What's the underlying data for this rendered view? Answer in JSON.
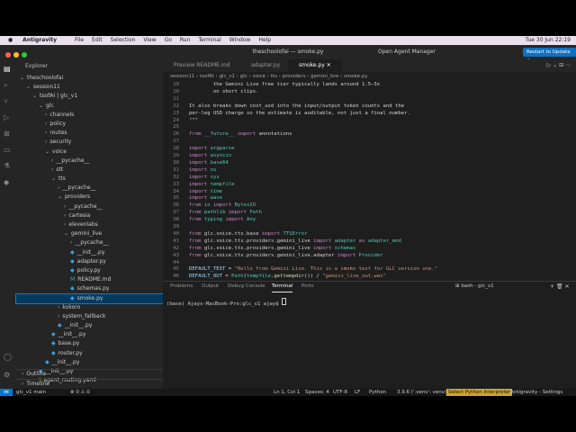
{
  "macmenu": {
    "app": "Antigravity",
    "items": [
      "File",
      "Edit",
      "Selection",
      "View",
      "Go",
      "Run",
      "Terminal",
      "Window",
      "Help"
    ],
    "clock": "Tue 30 Jun  22:19"
  },
  "window": {
    "title": "theschoolofai — smoke.py",
    "agent_manager": "Open Agent Manager",
    "restart": "Restart to Update ⇧"
  },
  "explorer": {
    "header": "Explorer",
    "tree": [
      {
        "label": "theschoolofai",
        "kind": "folder",
        "depth": 0,
        "open": true
      },
      {
        "label": "session11",
        "kind": "folder",
        "depth": 1,
        "open": true
      },
      {
        "label": "tsofAI | glc_v1",
        "kind": "folder",
        "depth": 2,
        "open": true
      },
      {
        "label": "glc",
        "kind": "folder",
        "depth": 3,
        "open": true
      },
      {
        "label": "channels",
        "kind": "folder",
        "depth": 4,
        "open": false
      },
      {
        "label": "policy",
        "kind": "folder",
        "depth": 4,
        "open": false
      },
      {
        "label": "routes",
        "kind": "folder",
        "depth": 4,
        "open": false
      },
      {
        "label": "security",
        "kind": "folder",
        "depth": 4,
        "open": false
      },
      {
        "label": "voice",
        "kind": "folder",
        "depth": 4,
        "open": true
      },
      {
        "label": "__pycache__",
        "kind": "folder",
        "depth": 5,
        "open": false
      },
      {
        "label": "stt",
        "kind": "folder",
        "depth": 5,
        "open": false
      },
      {
        "label": "tts",
        "kind": "folder",
        "depth": 5,
        "open": true
      },
      {
        "label": "__pycache__",
        "kind": "folder",
        "depth": 6,
        "open": false
      },
      {
        "label": "providers",
        "kind": "folder",
        "depth": 6,
        "open": true
      },
      {
        "label": "__pycache__",
        "kind": "folder",
        "depth": 7,
        "open": false
      },
      {
        "label": "cartesia",
        "kind": "folder",
        "depth": 7,
        "open": false
      },
      {
        "label": "elevenlabs",
        "kind": "folder",
        "depth": 7,
        "open": false
      },
      {
        "label": "gemini_live",
        "kind": "folder",
        "depth": 7,
        "open": true
      },
      {
        "label": "__pycache__",
        "kind": "folder",
        "depth": 8,
        "open": false
      },
      {
        "label": "__init__.py",
        "kind": "py",
        "depth": 8
      },
      {
        "label": "adapter.py",
        "kind": "py",
        "depth": 8
      },
      {
        "label": "policy.py",
        "kind": "py",
        "depth": 8
      },
      {
        "label": "README.md",
        "kind": "md",
        "depth": 8
      },
      {
        "label": "schemas.py",
        "kind": "py",
        "depth": 8
      },
      {
        "label": "smoke.py",
        "kind": "py",
        "depth": 8,
        "selected": true
      },
      {
        "label": "kokoro",
        "kind": "folder",
        "depth": 6,
        "open": false
      },
      {
        "label": "system_fallback",
        "kind": "folder",
        "depth": 6,
        "open": false
      },
      {
        "label": "__init__.py",
        "kind": "py",
        "depth": 6
      },
      {
        "label": "__init__.py",
        "kind": "py",
        "depth": 5
      },
      {
        "label": "base.py",
        "kind": "py",
        "depth": 5
      },
      {
        "label": "router.py",
        "kind": "py",
        "depth": 5
      },
      {
        "label": "__init__.py",
        "kind": "py",
        "depth": 4
      },
      {
        "label": "__init__.py",
        "kind": "py",
        "depth": 3
      },
      {
        "label": "agent_routing.yaml",
        "kind": "yml",
        "depth": 3
      }
    ],
    "outline": "Outline",
    "timeline": "Timeline"
  },
  "tabs": [
    {
      "label": "Preview README.md",
      "active": false
    },
    {
      "label": "adapter.py",
      "active": false
    },
    {
      "label": "smoke.py",
      "active": true
    }
  ],
  "breadcrumb": [
    "session11",
    "tsofAI",
    "glc_v1",
    "glc",
    "voice",
    "tts",
    "providers",
    "gemini_live",
    "smoke.py"
  ],
  "code": [
    {
      "n": "19",
      "parts": [
        [
          "c",
          "        the Gemini Live free tier typically lands around 1.5–3x"
        ]
      ]
    },
    {
      "n": "20",
      "parts": [
        [
          "c",
          "        on short clips."
        ]
      ]
    },
    {
      "n": "21",
      "parts": [
        [
          "c",
          ""
        ]
      ]
    },
    {
      "n": "22",
      "parts": [
        [
          "c",
          "It also breaks down cost_usd into the input/output token counts and the"
        ]
      ]
    },
    {
      "n": "23",
      "parts": [
        [
          "c",
          "per-leg USD charge so the estimate is auditable, not just a final number."
        ]
      ]
    },
    {
      "n": "24",
      "parts": [
        [
          "c",
          "\"\"\""
        ]
      ]
    },
    {
      "n": "25",
      "parts": [
        [
          "c",
          ""
        ]
      ]
    },
    {
      "n": "26",
      "parts": [
        [
          "k",
          "from"
        ],
        [
          "c",
          " "
        ],
        [
          "t",
          "__future__"
        ],
        [
          "c",
          " "
        ],
        [
          "k",
          "import"
        ],
        [
          "c",
          " annotations"
        ]
      ]
    },
    {
      "n": "27",
      "parts": [
        [
          "c",
          ""
        ]
      ]
    },
    {
      "n": "28",
      "parts": [
        [
          "k",
          "import"
        ],
        [
          "c",
          " "
        ],
        [
          "t",
          "argparse"
        ]
      ]
    },
    {
      "n": "29",
      "parts": [
        [
          "k",
          "import"
        ],
        [
          "c",
          " "
        ],
        [
          "t",
          "asyncio"
        ]
      ]
    },
    {
      "n": "30",
      "parts": [
        [
          "k",
          "import"
        ],
        [
          "c",
          " "
        ],
        [
          "t",
          "base64"
        ]
      ]
    },
    {
      "n": "31",
      "parts": [
        [
          "k",
          "import"
        ],
        [
          "c",
          " "
        ],
        [
          "t",
          "os"
        ]
      ]
    },
    {
      "n": "32",
      "parts": [
        [
          "k",
          "import"
        ],
        [
          "c",
          " "
        ],
        [
          "t",
          "sys"
        ]
      ]
    },
    {
      "n": "33",
      "parts": [
        [
          "k",
          "import"
        ],
        [
          "c",
          " "
        ],
        [
          "t",
          "tempfile"
        ]
      ]
    },
    {
      "n": "34",
      "parts": [
        [
          "k",
          "import"
        ],
        [
          "c",
          " "
        ],
        [
          "t",
          "time"
        ]
      ]
    },
    {
      "n": "35",
      "parts": [
        [
          "k",
          "import"
        ],
        [
          "c",
          " "
        ],
        [
          "t",
          "wave"
        ]
      ]
    },
    {
      "n": "36",
      "parts": [
        [
          "k",
          "from"
        ],
        [
          "c",
          " "
        ],
        [
          "t",
          "io"
        ],
        [
          "c",
          " "
        ],
        [
          "k",
          "import"
        ],
        [
          "c",
          " "
        ],
        [
          "t",
          "BytesIO"
        ]
      ]
    },
    {
      "n": "37",
      "parts": [
        [
          "k",
          "from"
        ],
        [
          "c",
          " "
        ],
        [
          "t",
          "pathlib"
        ],
        [
          "c",
          " "
        ],
        [
          "k",
          "import"
        ],
        [
          "c",
          " "
        ],
        [
          "t",
          "Path"
        ]
      ]
    },
    {
      "n": "38",
      "parts": [
        [
          "k",
          "from"
        ],
        [
          "c",
          " "
        ],
        [
          "t",
          "typing"
        ],
        [
          "c",
          " "
        ],
        [
          "k",
          "import"
        ],
        [
          "c",
          " "
        ],
        [
          "t",
          "Any"
        ]
      ]
    },
    {
      "n": "39",
      "parts": [
        [
          "c",
          ""
        ]
      ]
    },
    {
      "n": "40",
      "parts": [
        [
          "k",
          "from"
        ],
        [
          "c",
          " glc.voice.tts.base "
        ],
        [
          "k",
          "import"
        ],
        [
          "c",
          " "
        ],
        [
          "t",
          "TTSError"
        ]
      ]
    },
    {
      "n": "41",
      "parts": [
        [
          "k",
          "from"
        ],
        [
          "c",
          " glc.voice.tts.providers.gemini_live "
        ],
        [
          "k",
          "import"
        ],
        [
          "c",
          " "
        ],
        [
          "t",
          "adapter"
        ],
        [
          "c",
          " "
        ],
        [
          "k",
          "as"
        ],
        [
          "c",
          " "
        ],
        [
          "t",
          "adapter_mod"
        ]
      ]
    },
    {
      "n": "42",
      "parts": [
        [
          "k",
          "from"
        ],
        [
          "c",
          " glc.voice.tts.providers.gemini_live "
        ],
        [
          "k",
          "import"
        ],
        [
          "c",
          " "
        ],
        [
          "t",
          "schemas"
        ]
      ]
    },
    {
      "n": "43",
      "parts": [
        [
          "k",
          "from"
        ],
        [
          "c",
          " glc.voice.tts.providers.gemini_live.adapter "
        ],
        [
          "k",
          "import"
        ],
        [
          "c",
          " "
        ],
        [
          "t",
          "Provider"
        ]
      ]
    },
    {
      "n": "44",
      "parts": [
        [
          "c",
          ""
        ]
      ]
    },
    {
      "n": "45",
      "parts": [
        [
          "v",
          "DEFAULT_TEXT"
        ],
        [
          "c",
          " = "
        ],
        [
          "s",
          "\"Hello from Gemini Live. This is a smoke test for GLC version one.\""
        ]
      ]
    },
    {
      "n": "46",
      "parts": [
        [
          "v",
          "DEFAULT_OUT"
        ],
        [
          "c",
          " = "
        ],
        [
          "t",
          "Path"
        ],
        [
          "c",
          "("
        ],
        [
          "t",
          "tempfile"
        ],
        [
          "c",
          "."
        ],
        [
          "f",
          "gettempdir"
        ],
        [
          "c",
          "()) / "
        ],
        [
          "s",
          "\"gemini_live_out.wav\""
        ]
      ]
    }
  ],
  "panel": {
    "tabs": [
      "Problems",
      "Output",
      "Debug Console",
      "Terminal",
      "Ports"
    ],
    "active": "Terminal",
    "shell": "bash - glc_v1",
    "terminal_line": "(base) Ajays-MacBook-Pro:glc_v1 ajay$ "
  },
  "status": {
    "branch": "glc_v1  main",
    "problems": "⊗ 0  ⚠ 0",
    "position": "Ln 1, Col 1",
    "spaces": "Spaces: 4",
    "encoding": "UTF-8",
    "eol": "LF",
    "language": "Python",
    "env": "3.9.6 ('.venv': venv)",
    "interpreter": "Select Python Interpreter",
    "app": "Antigravity - Settings"
  },
  "colors": {
    "accent": "#0078d4",
    "selection": "#04395e",
    "interpreter": "#cfa429"
  }
}
